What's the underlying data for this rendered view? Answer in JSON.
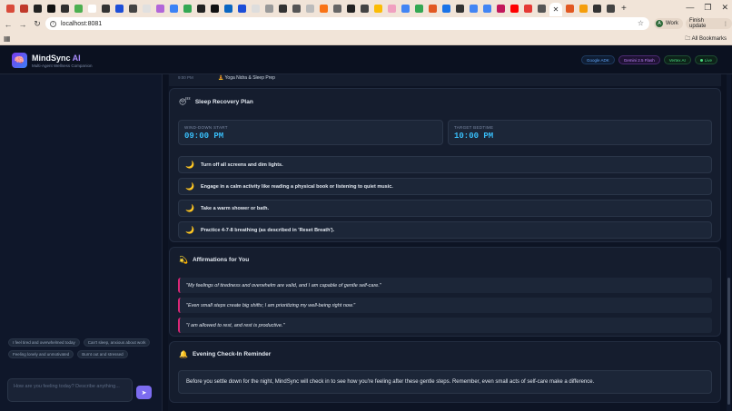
{
  "browser": {
    "url": "localhost:8081",
    "profile_name": "Work",
    "profile_initial": "A",
    "finish_update_label": "Finish update",
    "all_bookmarks_label": "All Bookmarks"
  },
  "header": {
    "brand_main": "MindSync",
    "brand_ai": " AI",
    "subtitle": "Multi-Agent Wellness Companion",
    "badges": [
      "Google ADK",
      "Gemini 2.5 Flash",
      "Vertex AI",
      "Live"
    ]
  },
  "sidebar": {
    "suggestions": [
      "I feel tired and overwhelmed today",
      "Can't sleep, anxious about work",
      "Feeling lonely and unmotivated",
      "Burnt out and stressed"
    ],
    "input_placeholder": "How are you feeling today? Describe anything...",
    "send_icon": "send-icon"
  },
  "prev_row": {
    "label": "9:00 PM",
    "value": "Yoga Nidra & Sleep Prep"
  },
  "sleep_plan": {
    "title": "Sleep Recovery Plan",
    "wind_down_label": "WIND-DOWN START",
    "wind_down_time": "09:00 PM",
    "bedtime_label": "TARGET BEDTIME",
    "bedtime_time": "10:00 PM",
    "steps": [
      "Turn off all screens and dim lights.",
      "Engage in a calm activity like reading a physical book or listening to quiet music.",
      "Take a warm shower or bath.",
      "Practice 4-7-8 breathing (as described in 'Reset Breath')."
    ]
  },
  "affirmations": {
    "title": "Affirmations for You",
    "items": [
      "\"My feelings of tiredness and overwhelm are valid, and I am capable of gentle self-care.\"",
      "\"Even small steps create big shifts; I am prioritizing my well-being right now.\"",
      "\"I am allowed to rest, and rest is productive.\""
    ]
  },
  "reminder": {
    "title": "Evening Check-In Reminder",
    "text": "Before you settle down for the night, MindSync will check in to see how you're feeling after these gentle steps. Remember, even small acts of self-care make a difference."
  },
  "colors": {
    "accent": "#7c6cf0",
    "time_text": "#38bdf8",
    "affirmation_border": "#db2777"
  }
}
